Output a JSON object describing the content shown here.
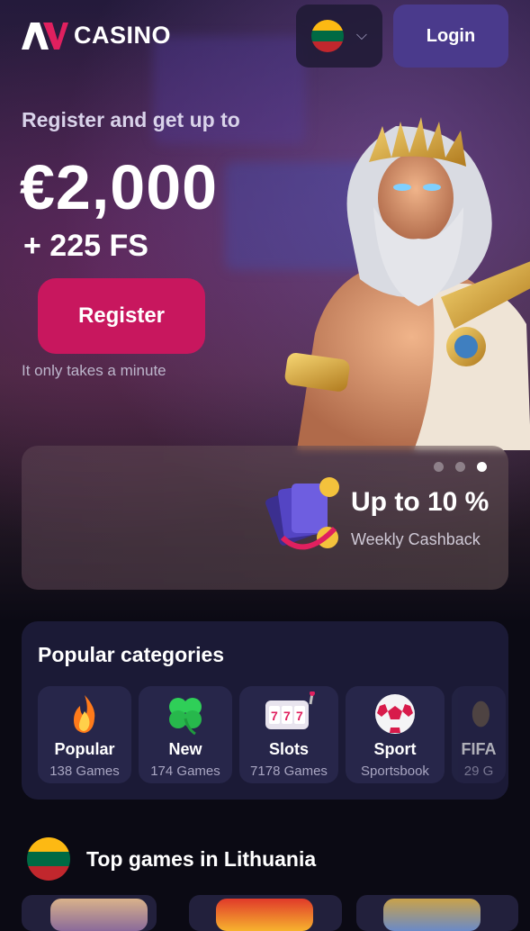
{
  "header": {
    "logo_text": "CASINO",
    "logo_mark": "AV",
    "language_flag": "lithuania-flag",
    "language_chevron": "⌄",
    "login_label": "Login"
  },
  "promo": {
    "subtitle": "Register and get up to",
    "amount": "€2,000",
    "free_spins": "+ 225 FS",
    "register_label": "Register",
    "note": "It only takes a minute"
  },
  "carousel": {
    "slide_count": 3,
    "active_slide": 3,
    "title": "Up to 10 %",
    "subtitle": "Weekly Cashback"
  },
  "categories": {
    "title": "Popular categories",
    "items": [
      {
        "name": "Popular",
        "count": "138 Games",
        "icon": "fire-icon"
      },
      {
        "name": "New",
        "count": "174 Games",
        "icon": "clover-icon"
      },
      {
        "name": "Slots",
        "count": "7178 Games",
        "icon": "slot-machine-icon"
      },
      {
        "name": "Sport",
        "count": "Sportsbook",
        "icon": "soccer-ball-icon"
      },
      {
        "name": "FIFA",
        "count": "29 G",
        "icon": "fifa-icon"
      }
    ]
  },
  "top_games": {
    "title": "Top games in Lithuania",
    "flag": "lithuania-flag"
  },
  "colors": {
    "accent_pink": "#c8175e",
    "login_purple": "#4a3a8c",
    "card_bg": "#1b1a36"
  }
}
